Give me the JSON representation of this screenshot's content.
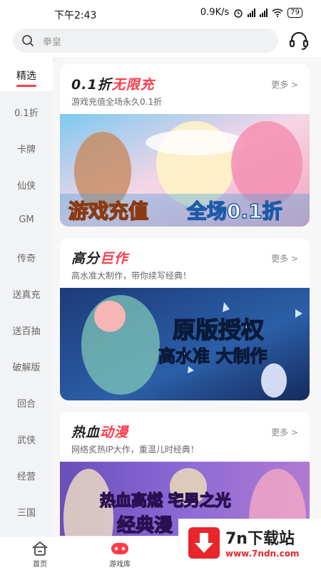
{
  "status_bar": {
    "time": "下午2:43",
    "speed": "0.9K/s",
    "battery": "79"
  },
  "search": {
    "placeholder": "拳皇"
  },
  "sidebar": {
    "items": [
      {
        "label": "精选"
      },
      {
        "label": "0.1折"
      },
      {
        "label": "卡牌"
      },
      {
        "label": "仙侠"
      },
      {
        "label": "GM"
      },
      {
        "label": "传奇"
      },
      {
        "label": "送真充"
      },
      {
        "label": "送百抽"
      },
      {
        "label": "破解版"
      },
      {
        "label": "回合"
      },
      {
        "label": "武侠"
      },
      {
        "label": "经营"
      },
      {
        "label": "三国"
      }
    ]
  },
  "sections": [
    {
      "title_a": "0.1折",
      "title_b": "无限充",
      "subtitle": "游戏充值全场永久0.1折",
      "more": "更多 >",
      "banner_text": [
        "游戏充值",
        "全场0.1折"
      ]
    },
    {
      "title_a": "高分",
      "title_b": "巨作",
      "subtitle": "高水准大制作，带你续写经典！",
      "more": "更多 >",
      "banner_text": [
        "原版授权",
        "高水准 大制作"
      ]
    },
    {
      "title_a": "热血",
      "title_b": "动漫",
      "subtitle": "网络炙热IP大作，重温儿时经典！",
      "more": "更多 >",
      "banner_text": [
        "热血高燃 宅男之光",
        "经典漫"
      ]
    }
  ],
  "bottom_nav": {
    "home": "首页",
    "library": "游戏库"
  },
  "watermark": {
    "name": "7n下载站",
    "url": "www.7ndn.com"
  },
  "colors": {
    "accent": "#ff3b4a",
    "bg": "#f2f3f5"
  },
  "icons": [
    "search-icon",
    "headset-icon",
    "home-icon",
    "gamepad-icon",
    "download-icon",
    "alarm-icon",
    "wifi-icon"
  ]
}
